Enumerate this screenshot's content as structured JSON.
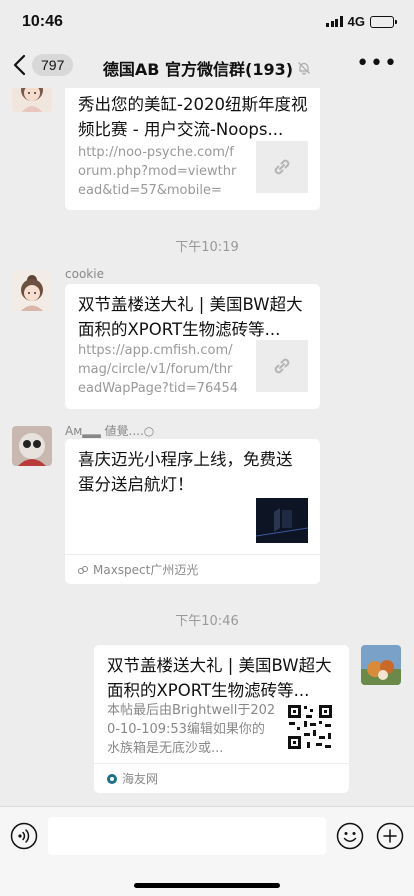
{
  "status": {
    "time": "10:46",
    "network": "4G",
    "battery_level": 0.35
  },
  "nav": {
    "back_count": "797",
    "title": "德国AB  官方微信群(193)"
  },
  "messages": [
    {
      "title": "秀出您的美缸-2020纽斯年度视频比赛 - 用户交流-Noops...",
      "desc": "http://noo-psyche.com/forum.php?mod=viewthread&tid=57&mobile=2..."
    },
    {
      "sender": "cookie",
      "title": "双节盖楼送大礼 | 美国BW超大面积的XPORT生物滤砖等...",
      "desc": "https://app.cmfish.com/mag/circle/v1/forum/threadWapPage?tid=764542&..."
    },
    {
      "sender": "Aм▂▂ 値覺....○",
      "title": "喜庆迈光小程序上线，免费送蛋分送启航灯！",
      "source": "Maxspect广州迈光"
    },
    {
      "title": "双节盖楼送大礼 | 美国BW超大面积的XPORT生物滤砖等...",
      "desc": "本帖最后由Brightwell于2020-10-109:53编辑如果你的水族箱是无底沙或...",
      "source": "海友网"
    }
  ],
  "timestamps": [
    "下午10:19",
    "下午10:46"
  ],
  "icons": {
    "back": "chevron-left-icon",
    "mute": "mute-bell-icon",
    "more": "more-icon",
    "link": "link-icon",
    "voice": "voice-icon",
    "emoji": "emoji-icon",
    "add": "plus-icon"
  },
  "colors": {
    "background": "#ededed",
    "bubble": "#ffffff",
    "meta_text": "#999999"
  }
}
